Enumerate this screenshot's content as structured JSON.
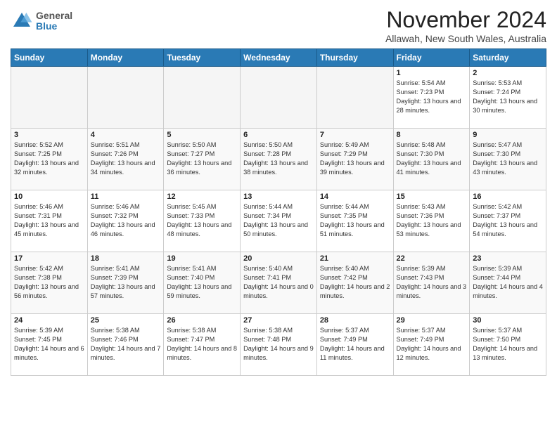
{
  "header": {
    "logo_general": "General",
    "logo_blue": "Blue",
    "month_title": "November 2024",
    "location": "Allawah, New South Wales, Australia"
  },
  "weekdays": [
    "Sunday",
    "Monday",
    "Tuesday",
    "Wednesday",
    "Thursday",
    "Friday",
    "Saturday"
  ],
  "weeks": [
    [
      {
        "day": null
      },
      {
        "day": null
      },
      {
        "day": null
      },
      {
        "day": null
      },
      {
        "day": null
      },
      {
        "day": "1",
        "sunrise": "5:54 AM",
        "sunset": "7:23 PM",
        "daylight": "13 hours and 28 minutes."
      },
      {
        "day": "2",
        "sunrise": "5:53 AM",
        "sunset": "7:24 PM",
        "daylight": "13 hours and 30 minutes."
      }
    ],
    [
      {
        "day": "3",
        "sunrise": "5:52 AM",
        "sunset": "7:25 PM",
        "daylight": "13 hours and 32 minutes."
      },
      {
        "day": "4",
        "sunrise": "5:51 AM",
        "sunset": "7:26 PM",
        "daylight": "13 hours and 34 minutes."
      },
      {
        "day": "5",
        "sunrise": "5:50 AM",
        "sunset": "7:27 PM",
        "daylight": "13 hours and 36 minutes."
      },
      {
        "day": "6",
        "sunrise": "5:50 AM",
        "sunset": "7:28 PM",
        "daylight": "13 hours and 38 minutes."
      },
      {
        "day": "7",
        "sunrise": "5:49 AM",
        "sunset": "7:29 PM",
        "daylight": "13 hours and 39 minutes."
      },
      {
        "day": "8",
        "sunrise": "5:48 AM",
        "sunset": "7:30 PM",
        "daylight": "13 hours and 41 minutes."
      },
      {
        "day": "9",
        "sunrise": "5:47 AM",
        "sunset": "7:30 PM",
        "daylight": "13 hours and 43 minutes."
      }
    ],
    [
      {
        "day": "10",
        "sunrise": "5:46 AM",
        "sunset": "7:31 PM",
        "daylight": "13 hours and 45 minutes."
      },
      {
        "day": "11",
        "sunrise": "5:46 AM",
        "sunset": "7:32 PM",
        "daylight": "13 hours and 46 minutes."
      },
      {
        "day": "12",
        "sunrise": "5:45 AM",
        "sunset": "7:33 PM",
        "daylight": "13 hours and 48 minutes."
      },
      {
        "day": "13",
        "sunrise": "5:44 AM",
        "sunset": "7:34 PM",
        "daylight": "13 hours and 50 minutes."
      },
      {
        "day": "14",
        "sunrise": "5:44 AM",
        "sunset": "7:35 PM",
        "daylight": "13 hours and 51 minutes."
      },
      {
        "day": "15",
        "sunrise": "5:43 AM",
        "sunset": "7:36 PM",
        "daylight": "13 hours and 53 minutes."
      },
      {
        "day": "16",
        "sunrise": "5:42 AM",
        "sunset": "7:37 PM",
        "daylight": "13 hours and 54 minutes."
      }
    ],
    [
      {
        "day": "17",
        "sunrise": "5:42 AM",
        "sunset": "7:38 PM",
        "daylight": "13 hours and 56 minutes."
      },
      {
        "day": "18",
        "sunrise": "5:41 AM",
        "sunset": "7:39 PM",
        "daylight": "13 hours and 57 minutes."
      },
      {
        "day": "19",
        "sunrise": "5:41 AM",
        "sunset": "7:40 PM",
        "daylight": "13 hours and 59 minutes."
      },
      {
        "day": "20",
        "sunrise": "5:40 AM",
        "sunset": "7:41 PM",
        "daylight": "14 hours and 0 minutes."
      },
      {
        "day": "21",
        "sunrise": "5:40 AM",
        "sunset": "7:42 PM",
        "daylight": "14 hours and 2 minutes."
      },
      {
        "day": "22",
        "sunrise": "5:39 AM",
        "sunset": "7:43 PM",
        "daylight": "14 hours and 3 minutes."
      },
      {
        "day": "23",
        "sunrise": "5:39 AM",
        "sunset": "7:44 PM",
        "daylight": "14 hours and 4 minutes."
      }
    ],
    [
      {
        "day": "24",
        "sunrise": "5:39 AM",
        "sunset": "7:45 PM",
        "daylight": "14 hours and 6 minutes."
      },
      {
        "day": "25",
        "sunrise": "5:38 AM",
        "sunset": "7:46 PM",
        "daylight": "14 hours and 7 minutes."
      },
      {
        "day": "26",
        "sunrise": "5:38 AM",
        "sunset": "7:47 PM",
        "daylight": "14 hours and 8 minutes."
      },
      {
        "day": "27",
        "sunrise": "5:38 AM",
        "sunset": "7:48 PM",
        "daylight": "14 hours and 9 minutes."
      },
      {
        "day": "28",
        "sunrise": "5:37 AM",
        "sunset": "7:49 PM",
        "daylight": "14 hours and 11 minutes."
      },
      {
        "day": "29",
        "sunrise": "5:37 AM",
        "sunset": "7:49 PM",
        "daylight": "14 hours and 12 minutes."
      },
      {
        "day": "30",
        "sunrise": "5:37 AM",
        "sunset": "7:50 PM",
        "daylight": "14 hours and 13 minutes."
      }
    ]
  ]
}
